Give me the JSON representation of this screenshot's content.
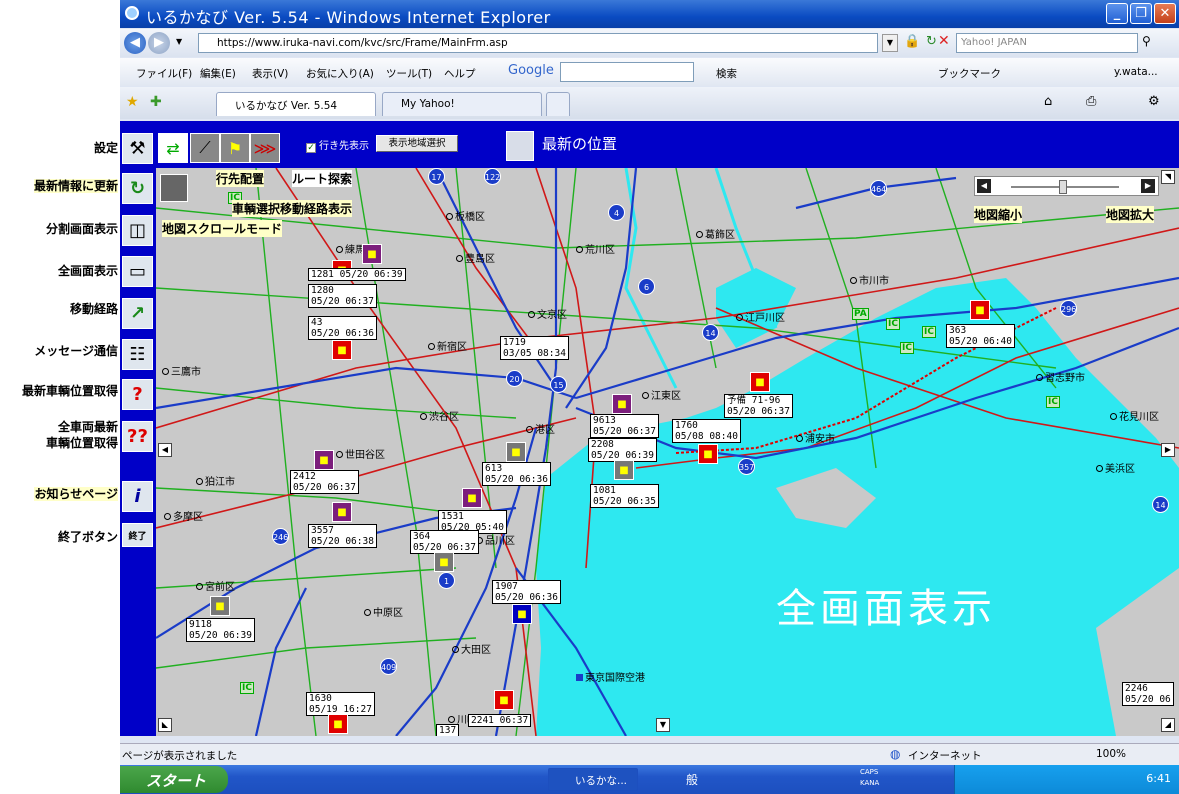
{
  "window": {
    "title": "いるかなび Ver. 5.54 - Windows Internet Explorer"
  },
  "address": {
    "url": "https://www.iruka-navi.com/kvc/src/Frame/MainFrm.asp",
    "search_placeholder": "Yahoo! JAPAN"
  },
  "menu": {
    "items": [
      "ファイル(F)",
      "編集(E)",
      "表示(V)",
      "お気に入り(A)",
      "ツール(T)",
      "ヘルプ"
    ],
    "google": "Google",
    "search_label": "検索",
    "bookmark": "ブックマーク",
    "user": "y.wata..."
  },
  "tabs": [
    {
      "label": "いるかなび Ver. 5.54"
    },
    {
      "label": "My Yahoo!"
    }
  ],
  "annotations": {
    "settings": "設定",
    "refresh": "最新情報に更新",
    "split": "分割画面表示",
    "full": "全画面表示",
    "route": "移動経路",
    "message": "メッセージ通信",
    "latest_pos": "最新車輌位置取得",
    "all_latest_1": "全車両最新",
    "all_latest_2": "車輌位置取得",
    "notice": "お知らせページ",
    "exit": "終了ボタン",
    "dest": "行先配置",
    "route_search": "ルート探索",
    "vehicle_route": "車輌選択移動経路表示",
    "scroll_mode": "地図スクロールモード",
    "zoom_out": "地図縮小",
    "zoom_in": "地図拡大"
  },
  "app": {
    "checkbox_label": "行き先表示",
    "region_button": "表示地域選択",
    "current_position": "最新の位置",
    "exit_button": "終了",
    "fullscreen_overlay": "全画面表示"
  },
  "wards": [
    "板橋区",
    "葛飾区",
    "荒川区",
    "豊島区",
    "市川市",
    "文京区",
    "江戸川区",
    "新宿区",
    "三鷹市",
    "江東区",
    "渋谷区",
    "港区",
    "浦安市",
    "習志野市",
    "花見川区",
    "世田谷区",
    "美浜区",
    "狛江市",
    "多摩区",
    "品川区",
    "宮前区",
    "大田区",
    "中原区",
    "東京国際空港",
    "川崎市",
    "練馬区"
  ],
  "vehicles": [
    {
      "id": "1281",
      "time": "05/20 06:39"
    },
    {
      "id": "1280",
      "time": "05/20 06:37"
    },
    {
      "id": "43",
      "time": "05/20 06:36"
    },
    {
      "id": "1719",
      "time": "03/05 08:34"
    },
    {
      "id": "363",
      "time": "05/20 06:40"
    },
    {
      "id": "予備 71-96",
      "time": "05/20 06:37"
    },
    {
      "id": "9613",
      "time": "05/20 06:37"
    },
    {
      "id": "1760",
      "time": "05/08 08:40"
    },
    {
      "id": "2208",
      "time": "05/20 06:39"
    },
    {
      "id": "1081",
      "time": "05/20 06:35"
    },
    {
      "id": "613",
      "time": "05/20 06:36"
    },
    {
      "id": "2412",
      "time": "05/20 06:37"
    },
    {
      "id": "1531",
      "time": "05/20 05:40"
    },
    {
      "id": "3557",
      "time": "05/20 06:38"
    },
    {
      "id": "364",
      "time": "05/20 06:37"
    },
    {
      "id": "1907",
      "time": "05/20 06:36"
    },
    {
      "id": "9118",
      "time": "05/20 06:39"
    },
    {
      "id": "1630",
      "time": "05/19 16:27"
    },
    {
      "id": "2241",
      "time": "06:37"
    },
    {
      "id": "137",
      "time": ""
    },
    {
      "id": "2246",
      "time": "05/20 06"
    }
  ],
  "shields": [
    "17",
    "122",
    "4",
    "464",
    "6",
    "14",
    "296",
    "20",
    "15",
    "357",
    "246",
    "1",
    "409",
    "14"
  ],
  "status": {
    "text": "ページが表示されました",
    "zone": "インターネット",
    "zoom": "100%"
  },
  "taskbar": {
    "start": "スタート",
    "active_item": "いるかな...",
    "ime": "般",
    "clock": "6:41",
    "caps": "CAPS",
    "kana": "KANA"
  }
}
